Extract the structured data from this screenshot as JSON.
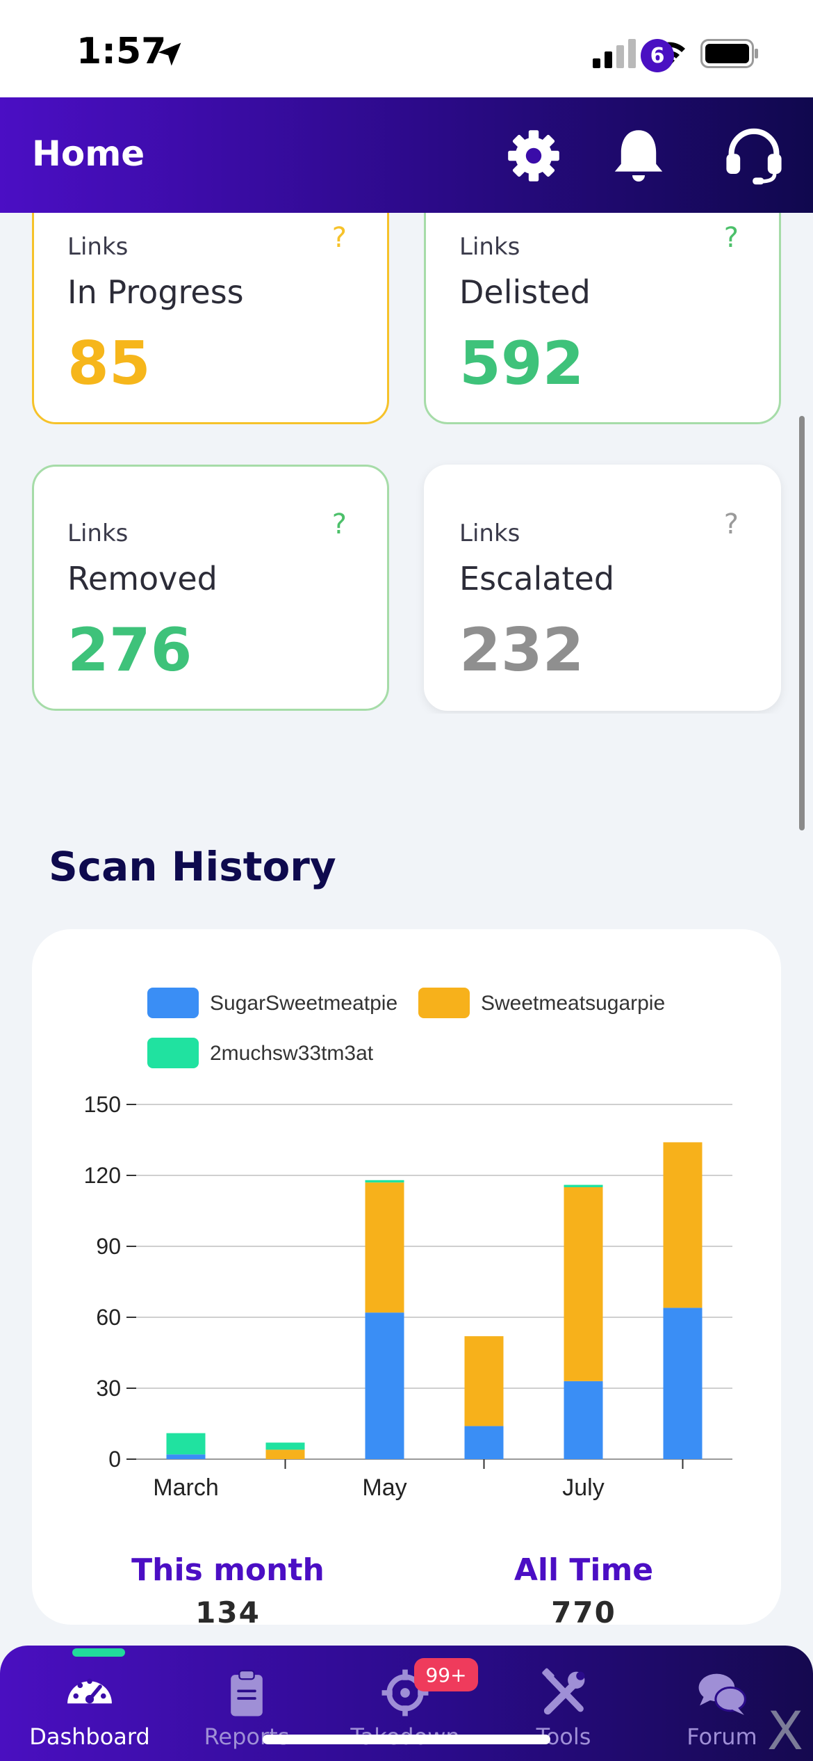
{
  "status_bar": {
    "time": "1:57"
  },
  "header": {
    "title": "Home",
    "notification_count": "6",
    "icons": [
      "gear-icon",
      "bell-icon",
      "headset-icon"
    ]
  },
  "stat_cards": [
    {
      "eyebrow": "Links",
      "label": "In Progress",
      "value": "85",
      "help": "?",
      "color": "#f6b61b"
    },
    {
      "eyebrow": "Links",
      "label": "Delisted",
      "value": "592",
      "help": "?",
      "color": "#3ec27a"
    },
    {
      "eyebrow": "Links",
      "label": "Removed",
      "value": "276",
      "help": "?",
      "color": "#3ec27a"
    },
    {
      "eyebrow": "Links",
      "label": "Escalated",
      "value": "232",
      "help": "?",
      "color": "#8f8f8f"
    }
  ],
  "scan_history": {
    "title": "Scan History",
    "summary": [
      {
        "label": "This month",
        "value": "134"
      },
      {
        "label": "All Time",
        "value": "770"
      }
    ]
  },
  "chart_data": {
    "type": "bar",
    "stacked": true,
    "categories": [
      "",
      "",
      "",
      "",
      "",
      ""
    ],
    "x_tick_labels": [
      "March",
      "",
      "May",
      "",
      "July",
      ""
    ],
    "series": [
      {
        "name": "SugarSweetmeatpie",
        "color": "#3a8ef5",
        "values": [
          2,
          0,
          62,
          14,
          33,
          64
        ]
      },
      {
        "name": "Sweetmeatsugarpie",
        "color": "#f7b11b",
        "values": [
          0,
          4,
          55,
          38,
          82,
          70
        ]
      },
      {
        "name": "2muchsw33tm3at",
        "color": "#20e2a0",
        "values": [
          9,
          3,
          1,
          0,
          1,
          0
        ]
      }
    ],
    "ylim": [
      0,
      150
    ],
    "yticks": [
      0,
      30,
      60,
      90,
      120,
      150
    ],
    "grid": true,
    "legend": "top"
  },
  "bottom_nav": {
    "items": [
      {
        "label": "Dashboard",
        "icon": "speedometer-icon",
        "active": true
      },
      {
        "label": "Reports",
        "icon": "clipboard-icon",
        "active": false
      },
      {
        "label": "Takedown",
        "icon": "crosshair-icon",
        "active": false
      },
      {
        "label": "Tools",
        "icon": "tools-icon",
        "active": false
      },
      {
        "label": "Forum",
        "icon": "chat-bubbles-icon",
        "active": false
      }
    ],
    "takedown_badge": "99+"
  },
  "overlay": {
    "close_label": "X"
  }
}
